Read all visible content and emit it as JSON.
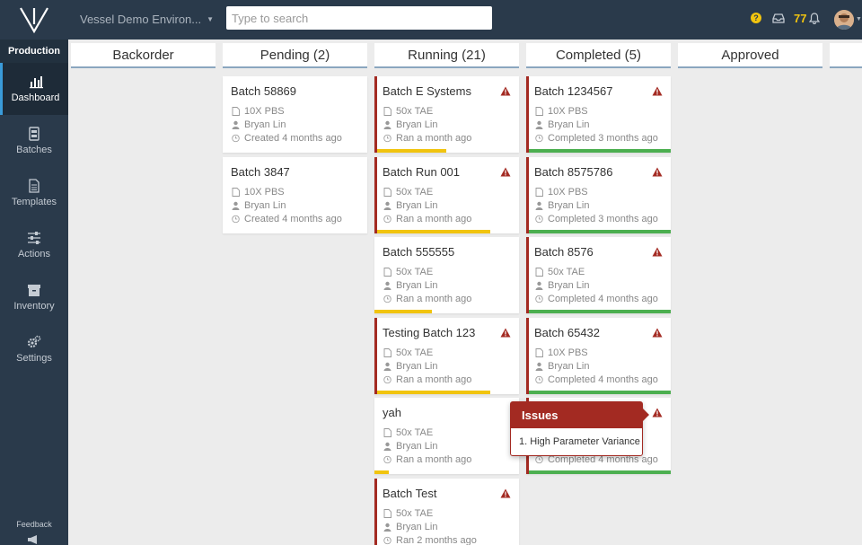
{
  "topbar": {
    "environment": "Vessel Demo Environ...",
    "search_placeholder": "Type to search",
    "help": "?",
    "notification_count": "77"
  },
  "sidebar": {
    "section": "Production",
    "items": [
      {
        "label": "Dashboard",
        "icon": "bar-chart-icon"
      },
      {
        "label": "Batches",
        "icon": "batches-icon"
      },
      {
        "label": "Templates",
        "icon": "document-icon"
      },
      {
        "label": "Actions",
        "icon": "sliders-icon"
      },
      {
        "label": "Inventory",
        "icon": "archive-icon"
      },
      {
        "label": "Settings",
        "icon": "gears-icon"
      }
    ],
    "feedback": "Feedback"
  },
  "columns": [
    {
      "title": "Backorder",
      "cards": []
    },
    {
      "title": "Pending (2)",
      "cards": [
        {
          "title": "Batch 58869",
          "recipe": "10X PBS",
          "owner": "Bryan Lin",
          "status": "Created 4 months ago",
          "alert": false
        },
        {
          "title": "Batch 3847",
          "recipe": "10X PBS",
          "owner": "Bryan Lin",
          "status": "Created 4 months ago",
          "alert": false
        }
      ]
    },
    {
      "title": "Running (21)",
      "cards": [
        {
          "title": "Batch E Systems",
          "recipe": "50x TAE",
          "owner": "Bryan Lin",
          "status": "Ran a month ago",
          "alert": true,
          "progress": 0.49
        },
        {
          "title": "Batch Run 001",
          "recipe": "50x TAE",
          "owner": "Bryan Lin",
          "status": "Ran a month ago",
          "alert": true,
          "progress": 0.8
        },
        {
          "title": "Batch 555555",
          "recipe": "50x TAE",
          "owner": "Bryan Lin",
          "status": "Ran a month ago",
          "alert": false,
          "progress": 0.4
        },
        {
          "title": "Testing Batch 123",
          "recipe": "50x TAE",
          "owner": "Bryan Lin",
          "status": "Ran a month ago",
          "alert": true,
          "progress": 0.8
        },
        {
          "title": "yah",
          "recipe": "50x TAE",
          "owner": "Bryan Lin",
          "status": "Ran a month ago",
          "alert": false,
          "progress": 0.1
        },
        {
          "title": "Batch Test",
          "recipe": "50x TAE",
          "owner": "Bryan Lin",
          "status": "Ran 2 months ago",
          "alert": true,
          "progress": 0
        }
      ]
    },
    {
      "title": "Completed (5)",
      "cards": [
        {
          "title": "Batch 1234567",
          "recipe": "10X PBS",
          "owner": "Bryan Lin",
          "status": "Completed 3 months ago",
          "alert": true
        },
        {
          "title": "Batch 8575786",
          "recipe": "10X PBS",
          "owner": "Bryan Lin",
          "status": "Completed 3 months ago",
          "alert": true
        },
        {
          "title": "Batch 8576",
          "recipe": "50x TAE",
          "owner": "Bryan Lin",
          "status": "Completed 4 months ago",
          "alert": true
        },
        {
          "title": "Batch 65432",
          "recipe": "10X PBS",
          "owner": "Bryan Lin",
          "status": "Completed 4 months ago",
          "alert": true
        },
        {
          "title": "",
          "recipe": "",
          "owner": "",
          "status": "Completed 4 months ago",
          "alert": true
        }
      ]
    },
    {
      "title": "Approved",
      "cards": []
    }
  ],
  "tooltip": {
    "title": "Issues",
    "items": [
      "1. High Parameter Variance"
    ]
  },
  "colors": {
    "nav": "#2a3a4b",
    "alert": "#a32a22",
    "running": "#f1c40f",
    "completed": "#4caf50"
  }
}
